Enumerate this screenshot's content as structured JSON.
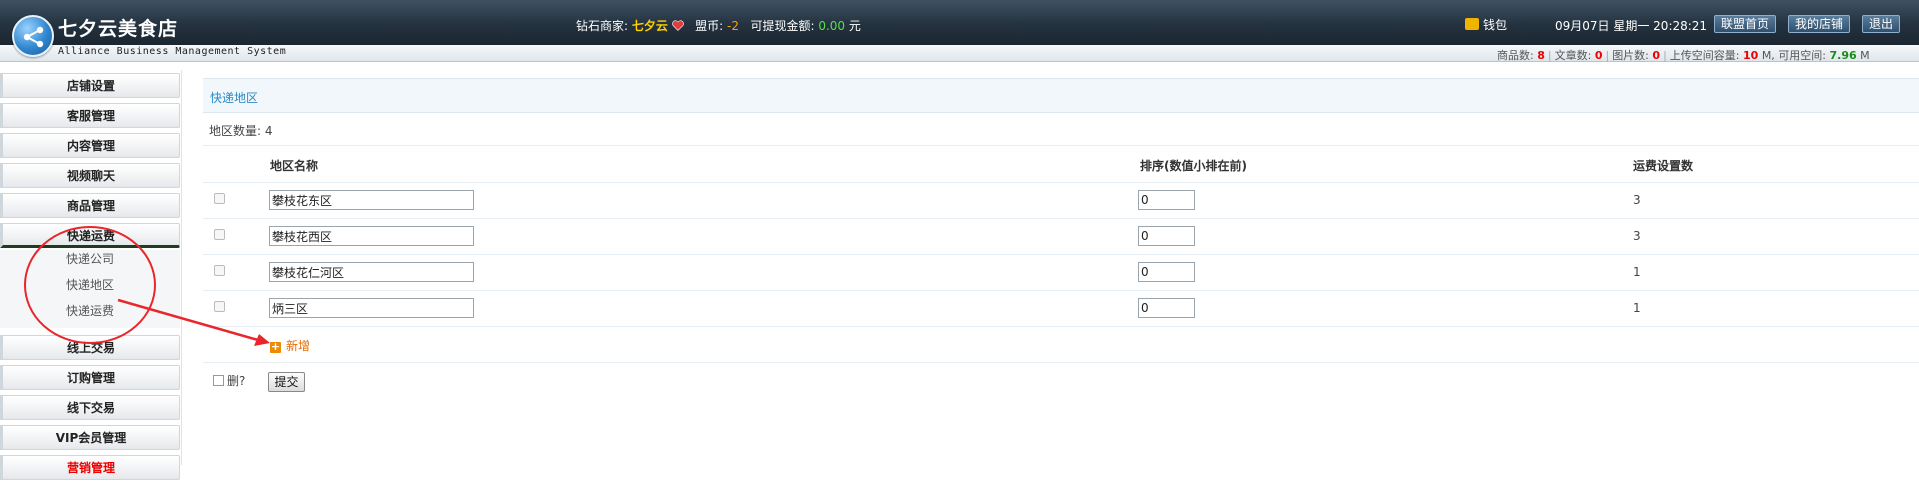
{
  "header": {
    "site_title": "七夕云美食店",
    "subtitle": "Alliance Business Management System",
    "merchant_label": "钻石商家:",
    "merchant_name": "七夕云",
    "coin_label": "盟币:",
    "coin_value": "-2",
    "withdraw_label": "可提现金额:",
    "withdraw_value": "0.00",
    "withdraw_unit": "元",
    "wallet_label": "钱包",
    "datetime": "09月07日 星期一 20:28:21",
    "buttons": [
      "联盟首页",
      "我的店铺",
      "退出"
    ],
    "stats": {
      "goods_label": "商品数:",
      "goods_value": "8",
      "articles_label": "文章数:",
      "articles_value": "0",
      "images_label": "图片数:",
      "images_value": "0",
      "upload_label": "上传空间容量:",
      "upload_value": "10",
      "upload_unit": "M,",
      "free_label": "可用空间:",
      "free_value": "7.96",
      "free_unit": "M"
    }
  },
  "sidebar": {
    "items": [
      "店铺设置",
      "客服管理",
      "内容管理",
      "视频聊天",
      "商品管理",
      "快递运费",
      "线上交易",
      "订购管理",
      "线下交易",
      "VIP会员管理",
      "营销管理"
    ],
    "submenu": [
      "快递公司",
      "快递地区",
      "快递运费"
    ]
  },
  "main": {
    "title": "快递地区",
    "count_label": "地区数量:",
    "count_value": "4",
    "columns": [
      "地区名称",
      "排序(数值小排在前)",
      "运费设置数"
    ],
    "rows": [
      {
        "name": "攀枝花东区",
        "order": "0",
        "fee_count": "3"
      },
      {
        "name": "攀枝花西区",
        "order": "0",
        "fee_count": "3"
      },
      {
        "name": "攀枝花仁河区",
        "order": "0",
        "fee_count": "1"
      },
      {
        "name": "炳三区",
        "order": "0",
        "fee_count": "1"
      }
    ],
    "add_label": "新增",
    "delete_label": "删?",
    "submit_label": "提交"
  },
  "colors": {
    "header_bg": "#24323f",
    "accent": "#2b89c8",
    "annotation": "#e8262b",
    "add_link": "#e86b00"
  },
  "icons": [
    "logo-share-icon",
    "heart-icon",
    "wallet-icon",
    "add-icon"
  ]
}
